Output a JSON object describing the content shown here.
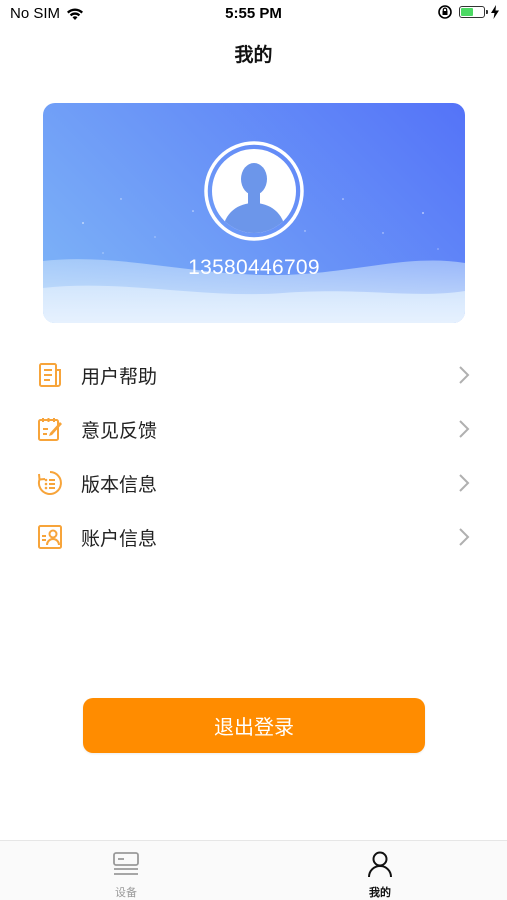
{
  "status_bar": {
    "carrier": "No SIM",
    "time": "5:55 PM",
    "battery_level": 0.55
  },
  "header": {
    "title": "我的"
  },
  "profile": {
    "phone": "13580446709"
  },
  "menu": {
    "items": [
      {
        "label": "用户帮助",
        "icon": "document-list-icon"
      },
      {
        "label": "意见反馈",
        "icon": "edit-note-icon"
      },
      {
        "label": "版本信息",
        "icon": "version-list-icon"
      },
      {
        "label": "账户信息",
        "icon": "account-card-icon"
      }
    ]
  },
  "actions": {
    "logout_label": "退出登录"
  },
  "tab_bar": {
    "tabs": [
      {
        "label": "设备",
        "icon": "device-icon",
        "active": false
      },
      {
        "label": "我的",
        "icon": "user-icon",
        "active": true
      }
    ]
  },
  "colors": {
    "accent": "#ff8c00",
    "icon_orange": "#f7a43a",
    "card_gradient_start": "#7fb6f7",
    "card_gradient_end": "#5473f8"
  }
}
